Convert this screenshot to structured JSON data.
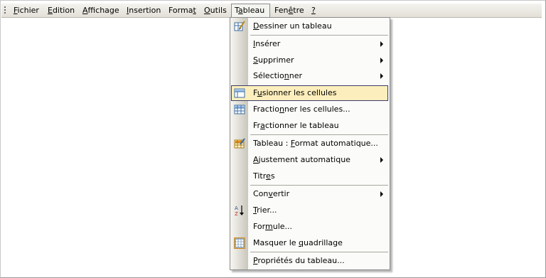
{
  "menubar": {
    "items": [
      {
        "pre": "",
        "acc": "F",
        "post": "ichier"
      },
      {
        "pre": "",
        "acc": "E",
        "post": "dition"
      },
      {
        "pre": "",
        "acc": "A",
        "post": "ffichage"
      },
      {
        "pre": "",
        "acc": "I",
        "post": "nsertion"
      },
      {
        "pre": "Forma",
        "acc": "t",
        "post": ""
      },
      {
        "pre": "",
        "acc": "O",
        "post": "utils"
      },
      {
        "pre": "T",
        "acc": "a",
        "post": "bleau"
      },
      {
        "pre": "Fen",
        "acc": "ê",
        "post": "tre"
      },
      {
        "pre": "",
        "acc": "?",
        "post": ""
      }
    ],
    "open_item": "Tableau"
  },
  "dropdown": {
    "items": [
      {
        "pre": "",
        "acc": "D",
        "post": "essiner un tableau",
        "icon": "draw-table-icon",
        "submenu": false
      },
      {
        "pre": "",
        "acc": "I",
        "post": "nsérer",
        "icon": "",
        "submenu": true
      },
      {
        "pre": "",
        "acc": "S",
        "post": "upprimer",
        "icon": "",
        "submenu": true
      },
      {
        "pre": "Sélectio",
        "acc": "n",
        "post": "ner",
        "icon": "",
        "submenu": true
      },
      {
        "pre": "F",
        "acc": "u",
        "post": "sionner les cellules",
        "icon": "merge-cells-icon",
        "submenu": false,
        "highlighted": true
      },
      {
        "pre": "Fractio",
        "acc": "n",
        "post": "ner les cellules...",
        "icon": "split-cells-icon",
        "submenu": false
      },
      {
        "pre": "Fr",
        "acc": "a",
        "post": "ctionner le tableau",
        "icon": "",
        "submenu": false
      },
      {
        "pre": "Tableau : ",
        "acc": "F",
        "post": "ormat automatique...",
        "icon": "autoformat-icon",
        "submenu": false
      },
      {
        "pre": "",
        "acc": "A",
        "post": "justement automatique",
        "icon": "",
        "submenu": true
      },
      {
        "pre": "Titr",
        "acc": "e",
        "post": "s",
        "icon": "",
        "submenu": false
      },
      {
        "pre": "Con",
        "acc": "v",
        "post": "ertir",
        "icon": "",
        "submenu": true
      },
      {
        "pre": "",
        "acc": "T",
        "post": "rier...",
        "icon": "sort-az-icon",
        "submenu": false
      },
      {
        "pre": "For",
        "acc": "m",
        "post": "ule...",
        "icon": "",
        "submenu": false
      },
      {
        "pre": "Masquer le ",
        "acc": "q",
        "post": "uadrillage",
        "icon": "hide-gridlines-icon",
        "submenu": false
      },
      {
        "pre": "",
        "acc": "P",
        "post": "ropriétés du tableau...",
        "icon": "",
        "submenu": false
      }
    ]
  },
  "colors": {
    "highlight_fill": "#fdefbd",
    "highlight_border": "#3c3c6a",
    "menubar_bg": "#ece9d8"
  }
}
